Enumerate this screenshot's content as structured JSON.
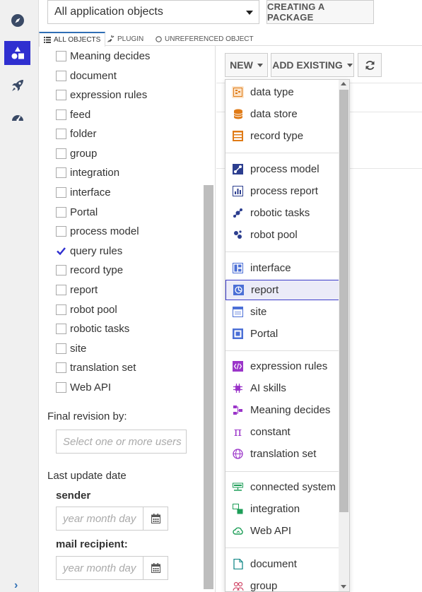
{
  "header": {
    "app_select": "All application objects",
    "package_button": "CREATING A PACKAGE"
  },
  "tabs": [
    {
      "label": "ALL OBJECTS"
    },
    {
      "label": "PLUGIN"
    },
    {
      "label": "UNREFERENCED OBJECT"
    }
  ],
  "filters": {
    "types": [
      {
        "label": "Meaning decides",
        "checked": false
      },
      {
        "label": "document",
        "checked": false
      },
      {
        "label": "expression rules",
        "checked": false
      },
      {
        "label": "feed",
        "checked": false
      },
      {
        "label": "folder",
        "checked": false
      },
      {
        "label": "group",
        "checked": false
      },
      {
        "label": "integration",
        "checked": false
      },
      {
        "label": "interface",
        "checked": false
      },
      {
        "label": "Portal",
        "checked": false
      },
      {
        "label": "process model",
        "checked": false
      },
      {
        "label": "query rules",
        "checked": true
      },
      {
        "label": "record type",
        "checked": false
      },
      {
        "label": "report",
        "checked": false
      },
      {
        "label": "robot pool",
        "checked": false
      },
      {
        "label": "robotic tasks",
        "checked": false
      },
      {
        "label": "site",
        "checked": false
      },
      {
        "label": "translation set",
        "checked": false
      },
      {
        "label": "Web API",
        "checked": false
      }
    ],
    "final_revision_label": "Final revision by:",
    "users_placeholder": "Select one or more users",
    "last_update_label": "Last update date",
    "sender_label": "sender",
    "sender_placeholder": "year month day",
    "recipient_label": "mail recipient:",
    "recipient_placeholder": "year month day"
  },
  "toolbar": {
    "new_label": "NEW",
    "add_existing_label": "ADD EXISTING"
  },
  "menu": {
    "items": [
      {
        "label": "data type",
        "icon": "data-type-icon",
        "color": "#e07b17"
      },
      {
        "label": "data store",
        "icon": "data-store-icon",
        "color": "#e07b17"
      },
      {
        "label": "record type",
        "icon": "record-type-icon",
        "color": "#e07b17"
      },
      {
        "label": "process model",
        "icon": "process-model-icon",
        "color": "#2c3e8f"
      },
      {
        "label": "process report",
        "icon": "process-report-icon",
        "color": "#2c3e8f"
      },
      {
        "label": "robotic tasks",
        "icon": "robotic-tasks-icon",
        "color": "#2c3e8f"
      },
      {
        "label": "robot pool",
        "icon": "robot-pool-icon",
        "color": "#2c3e8f"
      },
      {
        "label": "interface",
        "icon": "interface-icon",
        "color": "#4b6fd6"
      },
      {
        "label": "report",
        "icon": "report-icon",
        "color": "#4b6fd6",
        "highlighted": true
      },
      {
        "label": "site",
        "icon": "site-icon",
        "color": "#4b6fd6"
      },
      {
        "label": "Portal",
        "icon": "portal-icon",
        "color": "#4b6fd6"
      },
      {
        "label": "expression rules",
        "icon": "expression-rules-icon",
        "color": "#9b35c9"
      },
      {
        "label": "AI skills",
        "icon": "ai-skills-icon",
        "color": "#9b35c9"
      },
      {
        "label": "Meaning decides",
        "icon": "decision-icon",
        "color": "#9b35c9"
      },
      {
        "label": "constant",
        "icon": "constant-pi-icon",
        "color": "#9b35c9"
      },
      {
        "label": "translation set",
        "icon": "translation-set-icon",
        "color": "#9b35c9"
      },
      {
        "label": "connected system",
        "icon": "connected-system-icon",
        "color": "#1e9e58"
      },
      {
        "label": "integration",
        "icon": "integration-icon",
        "color": "#1e9e58"
      },
      {
        "label": "Web API",
        "icon": "web-api-icon",
        "color": "#1e9e58"
      },
      {
        "label": "document",
        "icon": "document-icon",
        "color": "#178a8a"
      },
      {
        "label": "group",
        "icon": "group-icon",
        "color": "#d14a6a"
      }
    ]
  }
}
